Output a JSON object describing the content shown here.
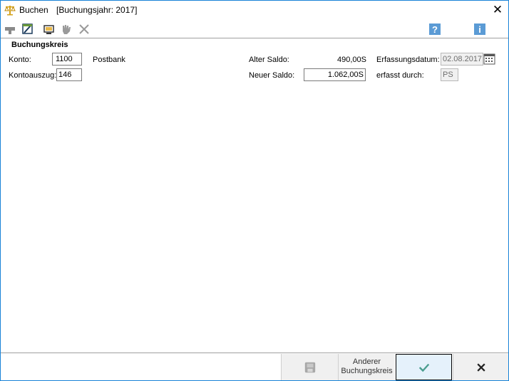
{
  "window": {
    "title": "Buchen",
    "subtitle": "[Buchungsjahr: 2017]"
  },
  "toolbar": {
    "icons": [
      "stamp-icon",
      "edit-document-icon",
      "monitor-icon",
      "hand-icon",
      "delete-cross-icon",
      "help-icon",
      "info-icon"
    ],
    "help_label": "?",
    "info_label": "i"
  },
  "group": {
    "title": "Buchungskreis"
  },
  "form": {
    "konto_label": "Konto:",
    "konto_value": "1100",
    "konto_name": "Postbank",
    "kontoauszug_label": "Kontoauszug:",
    "kontoauszug_value": "146",
    "alter_saldo_label": "Alter Saldo:",
    "alter_saldo_value": "490,00S",
    "neuer_saldo_label": "Neuer Saldo:",
    "neuer_saldo_value": "1.062,00S",
    "erfassungsdatum_label": "Erfassungsdatum:",
    "erfassungsdatum_value": "02.08.2017",
    "erfasst_durch_label": "erfasst durch:",
    "erfasst_durch_value": "PS"
  },
  "buttons": {
    "anderer_line1": "Anderer",
    "anderer_line2": "Buchungskreis"
  },
  "colors": {
    "accent": "#1883d7",
    "help_blue": "#5b9bd5",
    "ok_green": "#4a9d8f"
  }
}
